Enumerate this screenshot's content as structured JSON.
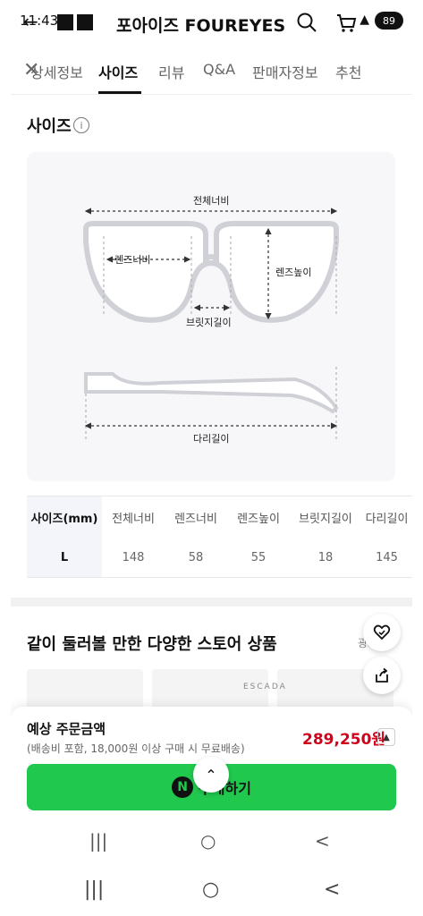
{
  "status": {
    "time": "11:43",
    "battery": "89"
  },
  "header": {
    "title": "포아이즈 FOUREYES"
  },
  "tabs": [
    {
      "label": "상세정보"
    },
    {
      "label": "사이즈"
    },
    {
      "label": "리뷰"
    },
    {
      "label": "Q&A"
    },
    {
      "label": "판매자정보"
    },
    {
      "label": "추천"
    }
  ],
  "size_section": {
    "title": "사이즈",
    "info_icon": "i",
    "diagram_labels": {
      "total_width": "전체너비",
      "lens_width": "렌즈너비",
      "lens_height": "렌즈높이",
      "bridge_length": "브릿지길이",
      "temple_length": "다리길이"
    },
    "table": {
      "headers": [
        "사이즈(mm)",
        "전체너비",
        "렌즈너비",
        "렌즈높이",
        "브릿지길이",
        "다리길이"
      ],
      "rows": [
        [
          "L",
          "148",
          "58",
          "55",
          "18",
          "145"
        ]
      ]
    }
  },
  "recommend": {
    "title": "같이 둘러볼 만한 다양한 스토어 상품",
    "ad_label": "광고",
    "card_brand": "ESCADA"
  },
  "sheet": {
    "title": "예상 주문금액",
    "note": "(배송비 포함, 18,000원 이상 구매 시 무료배송)",
    "price": "289,250원",
    "buy_label": "구매하기",
    "n_badge": "N",
    "scroll_top": "⌃"
  },
  "nav": {
    "recent": "|||",
    "home": "○",
    "back": "<"
  },
  "colors": {
    "buy_green": "#20c94e",
    "price_red": "#d0021b"
  }
}
